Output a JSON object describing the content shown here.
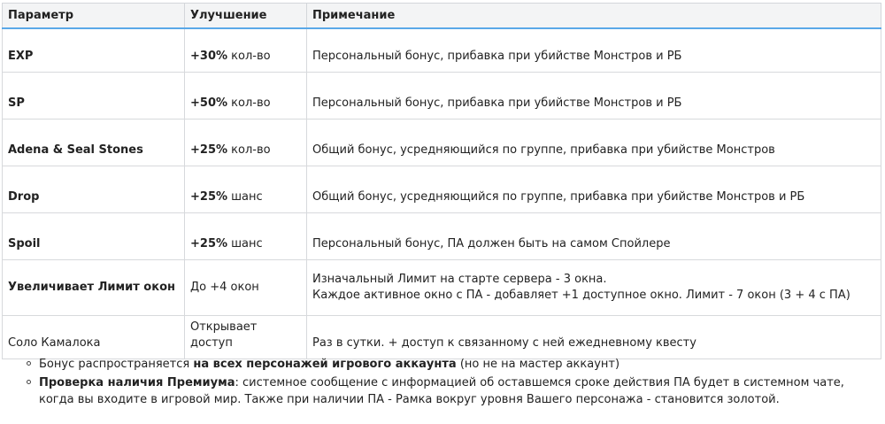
{
  "table": {
    "headers": [
      "Параметр",
      "Улучшение",
      "Примечание"
    ],
    "rows": [
      {
        "param": "EXP",
        "bold_param": true,
        "imp_bold": "+30%",
        "imp_rest": " кол-во",
        "note_lines": [
          "Персональный бонус, прибавка при убийстве Монстров и РБ"
        ]
      },
      {
        "param": "SP",
        "bold_param": true,
        "imp_bold": "+50%",
        "imp_rest": " кол-во",
        "note_lines": [
          "Персональный бонус, прибавка при убийстве Монстров и РБ"
        ]
      },
      {
        "param": "Adena & Seal Stones",
        "bold_param": true,
        "imp_bold": "+25%",
        "imp_rest": " кол-во",
        "note_lines": [
          "Общий бонус, усредняющийся по группе, прибавка при убийстве Монстров"
        ]
      },
      {
        "param": "Drop",
        "bold_param": true,
        "imp_bold": "+25%",
        "imp_rest": " шанс",
        "note_lines": [
          "Общий бонус, усредняющийся по группе, прибавка при убийстве Монстров и РБ"
        ]
      },
      {
        "param": "Spoil",
        "bold_param": true,
        "imp_bold": "+25%",
        "imp_rest": " шанс",
        "note_lines": [
          "Персональный бонус, ПА должен быть на самом Спойлере"
        ]
      },
      {
        "param": "Увеличивает Лимит окон",
        "bold_param": true,
        "imp_bold": "",
        "imp_rest": "До +4 окон",
        "note_lines": [
          "Изначальный Лимит на старте сервера - 3 окна.",
          "Каждое активное окно с ПА - добавляет +1 доступное окно. Лимит - 7 окон (3 + 4 с ПА)"
        ]
      },
      {
        "param": "Соло Камалока",
        "bold_param": false,
        "imp_bold": "",
        "imp_rest": "Открывает доступ",
        "note_lines": [
          "Раз в сутки. + доступ к связанному с ней ежедневному квесту"
        ]
      }
    ]
  },
  "notes": [
    {
      "pre": "Бонус распространяется ",
      "bold": "на всех персонажей игрового аккаунта",
      "post": " (но не на мастер аккаунт)"
    },
    {
      "pre": "",
      "bold": "Проверка наличия Премиума",
      "post": ": системное сообщение с информацией об оставшемся сроке действия ПА будет в системном чате, когда вы входите в игровой мир. Также при наличии ПА - Рамка вокруг уровня Вашего персонажа - становится золотой."
    }
  ]
}
